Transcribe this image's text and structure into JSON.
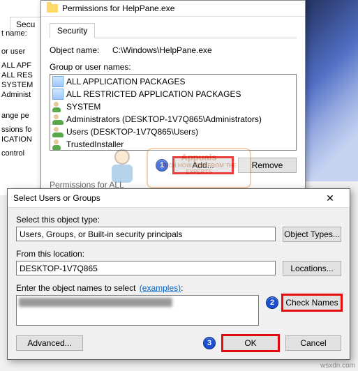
{
  "background": {
    "tab": "Secu",
    "left_items": [
      "t name:",
      "or user",
      "ALL APF",
      "ALL RES",
      "SYSTEM",
      "Administ",
      "",
      "ange pe",
      "ssions fo",
      "ICATION",
      "control"
    ]
  },
  "dlg1": {
    "title": "Permissions for HelpPane.exe",
    "tab": "Security",
    "object_label": "Object name:",
    "object_value": "C:\\Windows\\HelpPane.exe",
    "group_label": "Group or user names:",
    "items": [
      "ALL APPLICATION PACKAGES",
      "ALL RESTRICTED APPLICATION PACKAGES",
      "SYSTEM",
      "Administrators (DESKTOP-1V7Q865\\Administrators)",
      "Users (DESKTOP-1V7Q865\\Users)",
      "TrustedInstaller"
    ],
    "add": "Add...",
    "remove": "Remove",
    "perm_label_cut": "Permissions for ALL"
  },
  "dlg2": {
    "title": "Select Users or Groups",
    "close": "✕",
    "obj_type_lbl": "Select this object type:",
    "obj_type_val": "Users, Groups, or Built-in security principals",
    "obj_type_btn": "Object Types...",
    "loc_lbl": "From this location:",
    "loc_val": "DESKTOP-1V7Q865",
    "loc_btn": "Locations...",
    "names_lbl_a": "Enter the object names to select",
    "names_lbl_b": "(examples)",
    "check_btn": "Check Names",
    "advanced": "Advanced...",
    "ok": "OK",
    "cancel": "Cancel"
  },
  "badges": {
    "b1": "1",
    "b2": "2",
    "b3": "3"
  },
  "wm": {
    "brand": "Appuals",
    "tag": "TECH HOW-TO'S FROM THE EXPERTS"
  },
  "footer": "wsxdn.com"
}
